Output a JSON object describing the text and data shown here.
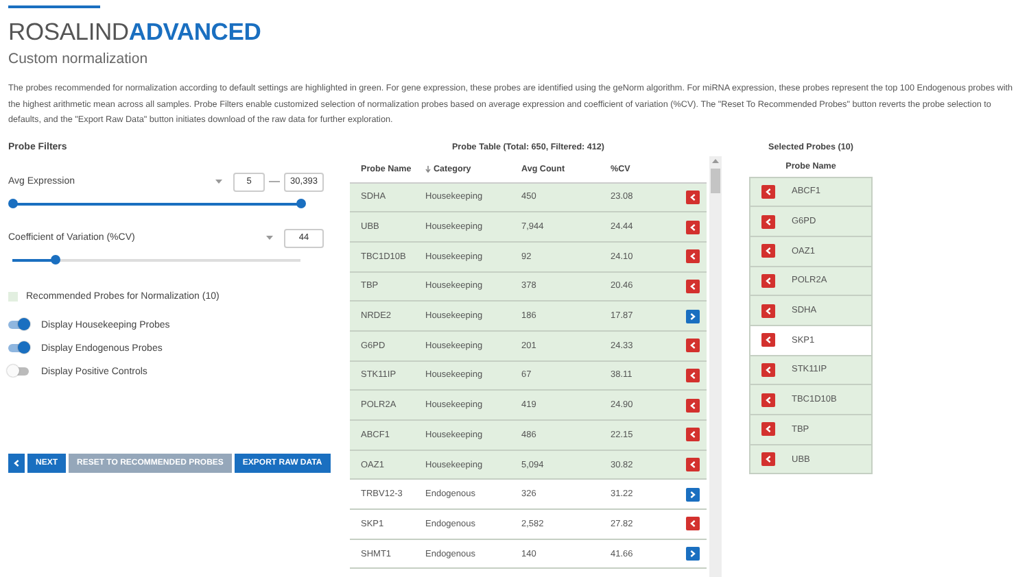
{
  "brand": {
    "name": "ROSALIND",
    "product": "ADVANCED"
  },
  "subtitle": "Custom normalization",
  "description": "The probes recommended for normalization according to default settings are highlighted in green. For gene expression, these probes are identified using the geNorm algorithm. For miRNA expression, these probes represent the top 100 Endogenous probes with the highest arithmetic mean across all samples. Probe Filters enable customized selection of normalization probes based on average expression and coefficient of variation (%CV). The \"Reset To Recommended Probes\" button reverts the probe selection to defaults, and the \"Export Raw Data\" button initiates download of the raw data for further exploration.",
  "filters": {
    "title": "Probe Filters",
    "avg_expression": {
      "label": "Avg Expression",
      "min": "5",
      "max": "30,393",
      "thumbs": [
        {
          "level": 0
        },
        {
          "level": 1
        }
      ]
    },
    "cv": {
      "label": "Coefficient of Variation (%CV)",
      "value": "44",
      "level": 0.15
    },
    "legend": "Recommended Probes for Normalization (10)",
    "toggles": [
      {
        "label": "Display Housekeeping Probes",
        "on": true
      },
      {
        "label": "Display Endogenous Probes",
        "on": true
      },
      {
        "label": "Display Positive Controls",
        "on": false
      }
    ]
  },
  "buttons": [
    {
      "kind": "back",
      "disabled": false
    },
    {
      "kind": "text",
      "label": "NEXT",
      "disabled": false
    },
    {
      "kind": "text",
      "label": "RESET TO RECOMMENDED PROBES",
      "disabled": true
    },
    {
      "kind": "text",
      "label": "EXPORT RAW DATA",
      "disabled": false
    }
  ],
  "probe_table": {
    "title": "Probe Table (Total: 650, Filtered: 412)",
    "columns": [
      {
        "label": "Probe Name",
        "sorted": false
      },
      {
        "label": "Category",
        "sorted": true
      },
      {
        "label": "Avg Count",
        "sorted": false
      },
      {
        "label": "%CV",
        "sorted": false
      }
    ],
    "rows": [
      {
        "name": "SDHA",
        "category": "Housekeeping",
        "avg_count": "450",
        "cv": "23.08",
        "recommended": true,
        "selected": true
      },
      {
        "name": "UBB",
        "category": "Housekeeping",
        "avg_count": "7,944",
        "cv": "24.44",
        "recommended": true,
        "selected": true
      },
      {
        "name": "TBC1D10B",
        "category": "Housekeeping",
        "avg_count": "92",
        "cv": "24.10",
        "recommended": true,
        "selected": true
      },
      {
        "name": "TBP",
        "category": "Housekeeping",
        "avg_count": "378",
        "cv": "20.46",
        "recommended": true,
        "selected": true
      },
      {
        "name": "NRDE2",
        "category": "Housekeeping",
        "avg_count": "186",
        "cv": "17.87",
        "recommended": true,
        "selected": false
      },
      {
        "name": "G6PD",
        "category": "Housekeeping",
        "avg_count": "201",
        "cv": "24.33",
        "recommended": true,
        "selected": true
      },
      {
        "name": "STK11IP",
        "category": "Housekeeping",
        "avg_count": "67",
        "cv": "38.11",
        "recommended": true,
        "selected": true
      },
      {
        "name": "POLR2A",
        "category": "Housekeeping",
        "avg_count": "419",
        "cv": "24.90",
        "recommended": true,
        "selected": true
      },
      {
        "name": "ABCF1",
        "category": "Housekeeping",
        "avg_count": "486",
        "cv": "22.15",
        "recommended": true,
        "selected": true
      },
      {
        "name": "OAZ1",
        "category": "Housekeeping",
        "avg_count": "5,094",
        "cv": "30.82",
        "recommended": true,
        "selected": true
      },
      {
        "name": "TRBV12-3",
        "category": "Endogenous",
        "avg_count": "326",
        "cv": "31.22",
        "recommended": false,
        "selected": false
      },
      {
        "name": "SKP1",
        "category": "Endogenous",
        "avg_count": "2,582",
        "cv": "27.82",
        "recommended": false,
        "selected": true
      },
      {
        "name": "SHMT1",
        "category": "Endogenous",
        "avg_count": "140",
        "cv": "41.66",
        "recommended": false,
        "selected": false
      }
    ]
  },
  "selected_probes": {
    "title": "Selected Probes (10)",
    "column": "Probe Name",
    "items": [
      {
        "name": "ABCF1",
        "recommended": true
      },
      {
        "name": "G6PD",
        "recommended": true
      },
      {
        "name": "OAZ1",
        "recommended": true
      },
      {
        "name": "POLR2A",
        "recommended": true
      },
      {
        "name": "SDHA",
        "recommended": true
      },
      {
        "name": "SKP1",
        "recommended": false
      },
      {
        "name": "STK11IP",
        "recommended": true
      },
      {
        "name": "TBC1D10B",
        "recommended": true
      },
      {
        "name": "TBP",
        "recommended": true
      },
      {
        "name": "UBB",
        "recommended": true
      }
    ]
  }
}
